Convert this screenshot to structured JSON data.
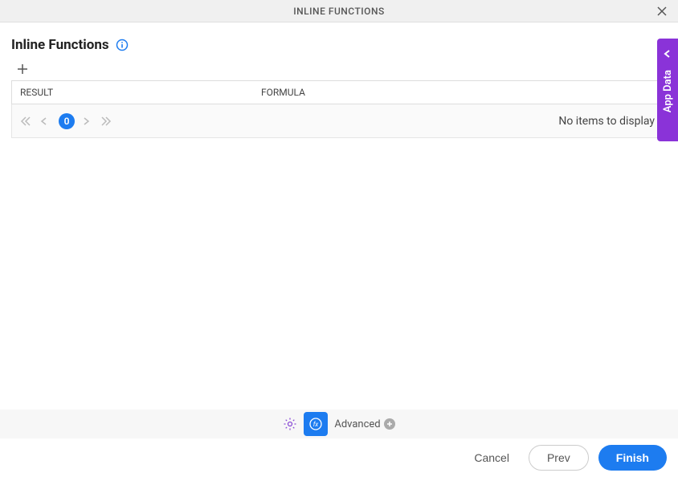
{
  "header": {
    "title": "INLINE FUNCTIONS"
  },
  "page": {
    "title": "Inline Functions"
  },
  "table": {
    "columns": {
      "result": "RESULT",
      "formula": "FORMULA"
    },
    "empty_message": "No items to display",
    "pager": {
      "current": "0"
    }
  },
  "toolbar": {
    "advanced_label": "Advanced"
  },
  "actions": {
    "cancel": "Cancel",
    "prev": "Prev",
    "finish": "Finish"
  },
  "side_tab": {
    "label": "App Data"
  }
}
